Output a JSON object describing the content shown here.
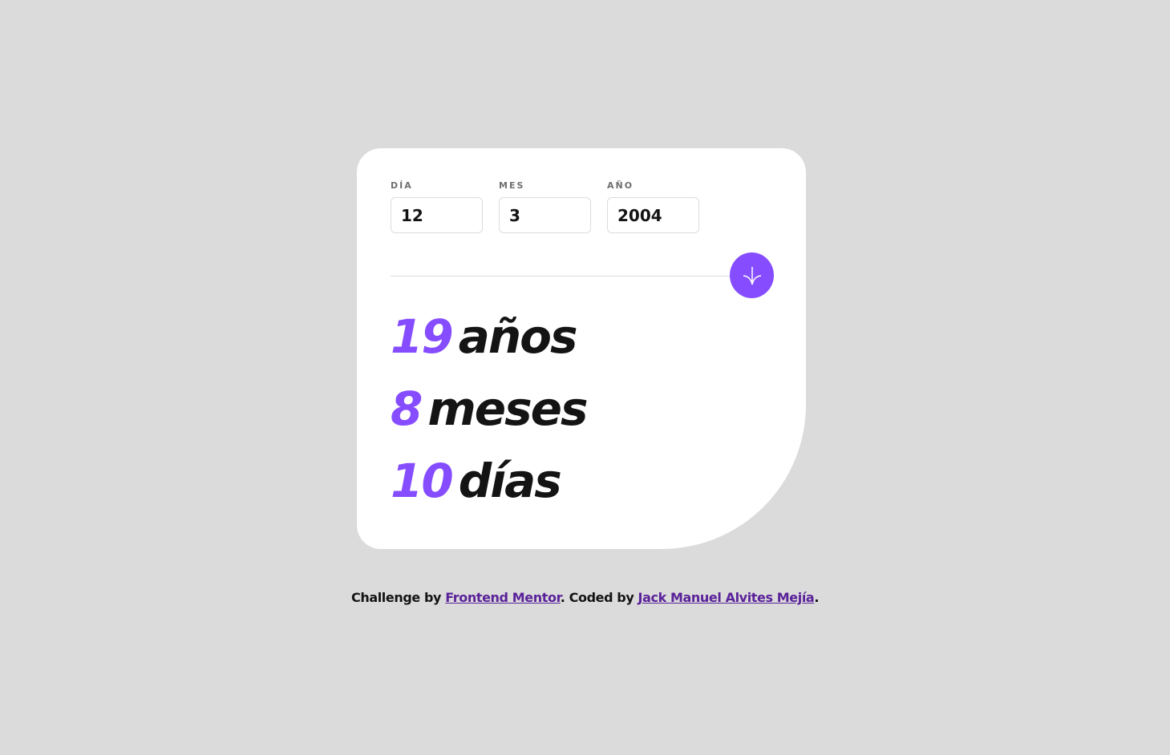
{
  "form": {
    "day": {
      "label": "DÍA",
      "value": "12"
    },
    "month": {
      "label": "MES",
      "value": "3"
    },
    "year": {
      "label": "AÑO",
      "value": "2004"
    },
    "submit_icon": "arrow-down-icon"
  },
  "results": {
    "years": {
      "value": "19",
      "unit": "años"
    },
    "months": {
      "value": "8",
      "unit": "meses"
    },
    "days": {
      "value": "10",
      "unit": "días"
    }
  },
  "attribution": {
    "prefix": "Challenge by ",
    "link1": "Frontend Mentor",
    "middle": ". Coded by ",
    "link2": "Jack Manuel Alvites Mejía",
    "suffix": "."
  },
  "colors": {
    "accent": "#854dff",
    "background": "#dbdbdb",
    "card": "#ffffff",
    "text": "#141414",
    "label": "#6f6f6f",
    "link": "#5a2299"
  }
}
